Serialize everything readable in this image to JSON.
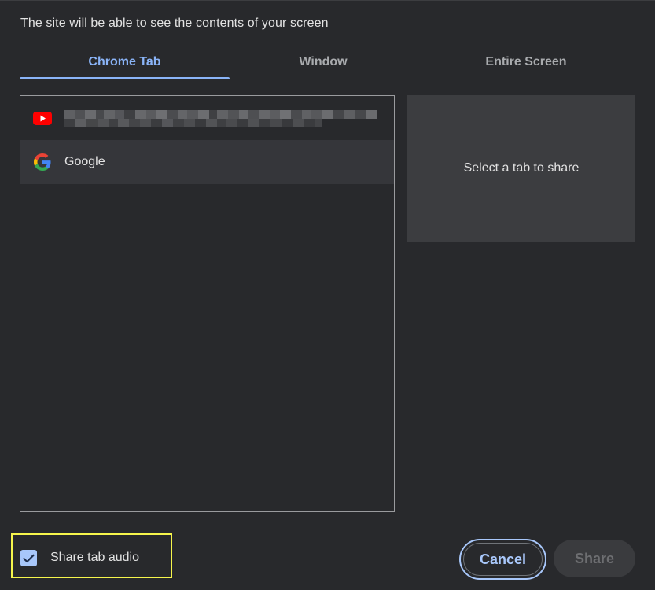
{
  "dialog": {
    "header": "The site will be able to see the contents of your screen"
  },
  "tabs": [
    {
      "label": "Chrome Tab",
      "active": true
    },
    {
      "label": "Window",
      "active": false
    },
    {
      "label": "Entire Screen",
      "active": false
    }
  ],
  "tab_list": {
    "items": [
      {
        "icon": "youtube-icon",
        "title": "",
        "title_obscured": true
      },
      {
        "icon": "google-icon",
        "title": "Google",
        "title_obscured": false
      }
    ]
  },
  "preview": {
    "text": "Select a tab to share"
  },
  "audio": {
    "label": "Share tab audio",
    "checked": true,
    "highlight_color": "#f6f54c"
  },
  "buttons": {
    "cancel_label": "Cancel",
    "share_label": "Share",
    "share_enabled": false
  },
  "colors": {
    "accent": "#8ab4f8",
    "background": "#28292c",
    "checkbox": "#a8c7fa"
  }
}
